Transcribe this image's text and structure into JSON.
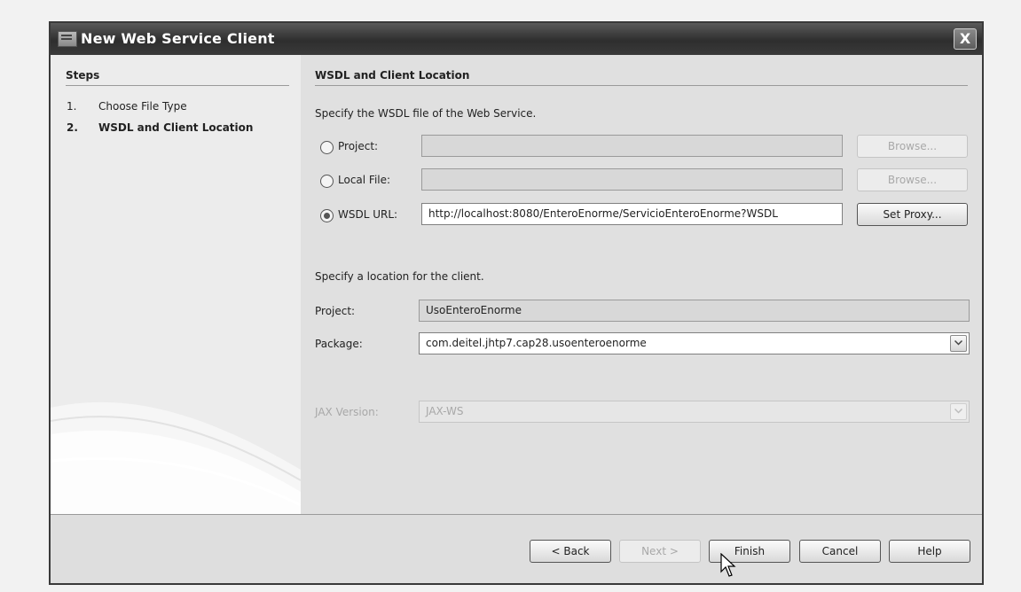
{
  "window": {
    "title": "New Web Service Client",
    "close_label": "X"
  },
  "sidebar": {
    "heading": "Steps",
    "steps": [
      {
        "num": "1.",
        "label": "Choose File Type"
      },
      {
        "num": "2.",
        "label": "WSDL and Client Location"
      }
    ]
  },
  "main": {
    "heading": "WSDL and Client Location",
    "wsdl_instruction": "Specify the WSDL file of the Web Service.",
    "project_label": "Project:",
    "project_value": "",
    "local_file_label": "Local File:",
    "local_file_value": "",
    "wsdl_url_label": "WSDL URL:",
    "wsdl_url_value": "http://localhost:8080/EnteroEnorme/ServicioEnteroEnorme?WSDL",
    "browse_label": "Browse...",
    "set_proxy_label": "Set Proxy...",
    "selected_source": "WSDL URL",
    "client_instruction": "Specify a location for the client.",
    "client_project_label": "Project:",
    "client_project_value": "UsoEnteroEnorme",
    "package_label": "Package:",
    "package_value": "com.deitel.jhtp7.cap28.usoenteroenorme",
    "jax_label": "JAX Version:",
    "jax_value": "JAX-WS"
  },
  "footer": {
    "back_label": "< Back",
    "next_label": "Next >",
    "finish_label": "Finish",
    "cancel_label": "Cancel",
    "help_label": "Help"
  }
}
